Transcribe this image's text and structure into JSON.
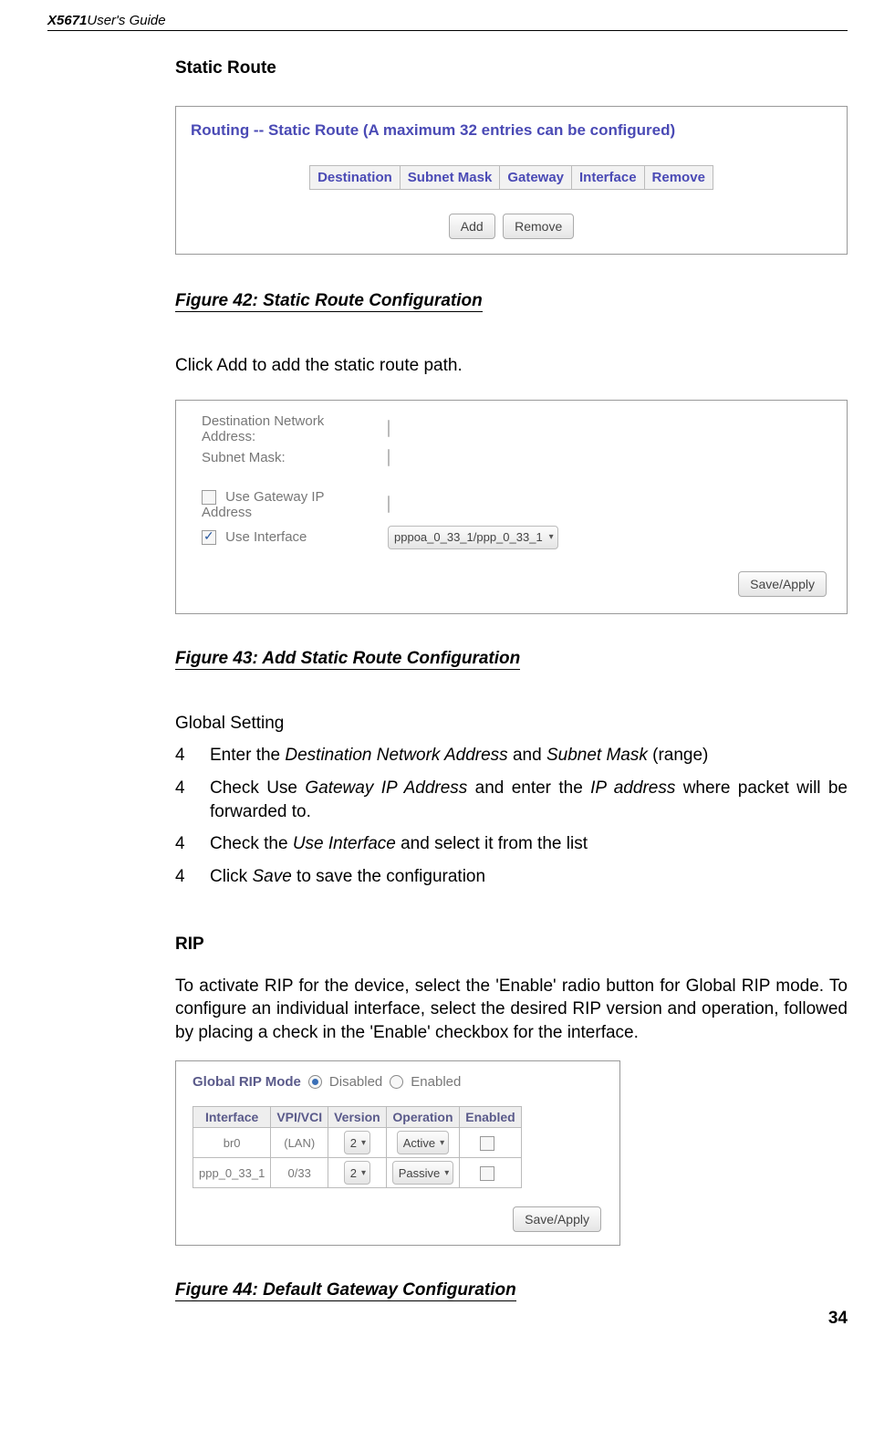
{
  "header": {
    "model": "X5671",
    "guide": " User's Guide"
  },
  "static_route": {
    "heading": "Static Route",
    "panel_title": "Routing -- Static Route (A maximum 32 entries can be configured)",
    "table_headers": [
      "Destination",
      "Subnet Mask",
      "Gateway",
      "Interface",
      "Remove"
    ],
    "btn_add": "Add",
    "btn_remove": "Remove",
    "caption": "Figure 42: Static Route Configuration",
    "desc": "Click Add to add the static route path."
  },
  "add_route": {
    "lbl_dest": "Destination Network Address:",
    "lbl_mask": "Subnet Mask:",
    "chk_gw": "Use Gateway IP Address",
    "chk_if": "Use Interface",
    "sel_if": "pppoa_0_33_1/ppp_0_33_1",
    "btn_save": "Save/Apply",
    "caption": "Figure 43: Add Static Route Configuration"
  },
  "global_setting": {
    "title": "Global Setting",
    "items": [
      {
        "num": "4",
        "pre": "Enter the ",
        "i1": "Destination Network Address",
        "mid": " and ",
        "i2": "Subnet Mask",
        "post": " (range)"
      },
      {
        "num": "4",
        "pre": "Check Use ",
        "i1": "Gateway IP Address",
        "mid": " and enter the ",
        "i2": "IP address",
        "post": " where packet will be forwarded to."
      },
      {
        "num": "4",
        "pre": "Check the ",
        "i1": "Use Interface",
        "mid": " and select it from the list",
        "i2": "",
        "post": ""
      },
      {
        "num": "4",
        "pre": "Click ",
        "i1": "Save",
        "mid": " to save the configuration",
        "i2": "",
        "post": ""
      }
    ]
  },
  "rip": {
    "heading": "RIP",
    "desc": "To activate RIP for the device, select the 'Enable' radio button for Global RIP mode. To configure an individual interface, select the desired RIP version and operation, followed by placing a check in the 'Enable' checkbox for the interface.",
    "mode_label": "Global RIP Mode",
    "opt_disabled": "Disabled",
    "opt_enabled": "Enabled",
    "table_headers": [
      "Interface",
      "VPI/VCI",
      "Version",
      "Operation",
      "Enabled"
    ],
    "rows": [
      {
        "if": "br0",
        "vpi": "(LAN)",
        "ver": "2",
        "op": "Active"
      },
      {
        "if": "ppp_0_33_1",
        "vpi": "0/33",
        "ver": "2",
        "op": "Passive"
      }
    ],
    "btn_save": "Save/Apply",
    "caption": "Figure 44: Default Gateway Configuration"
  },
  "page_number": "34"
}
